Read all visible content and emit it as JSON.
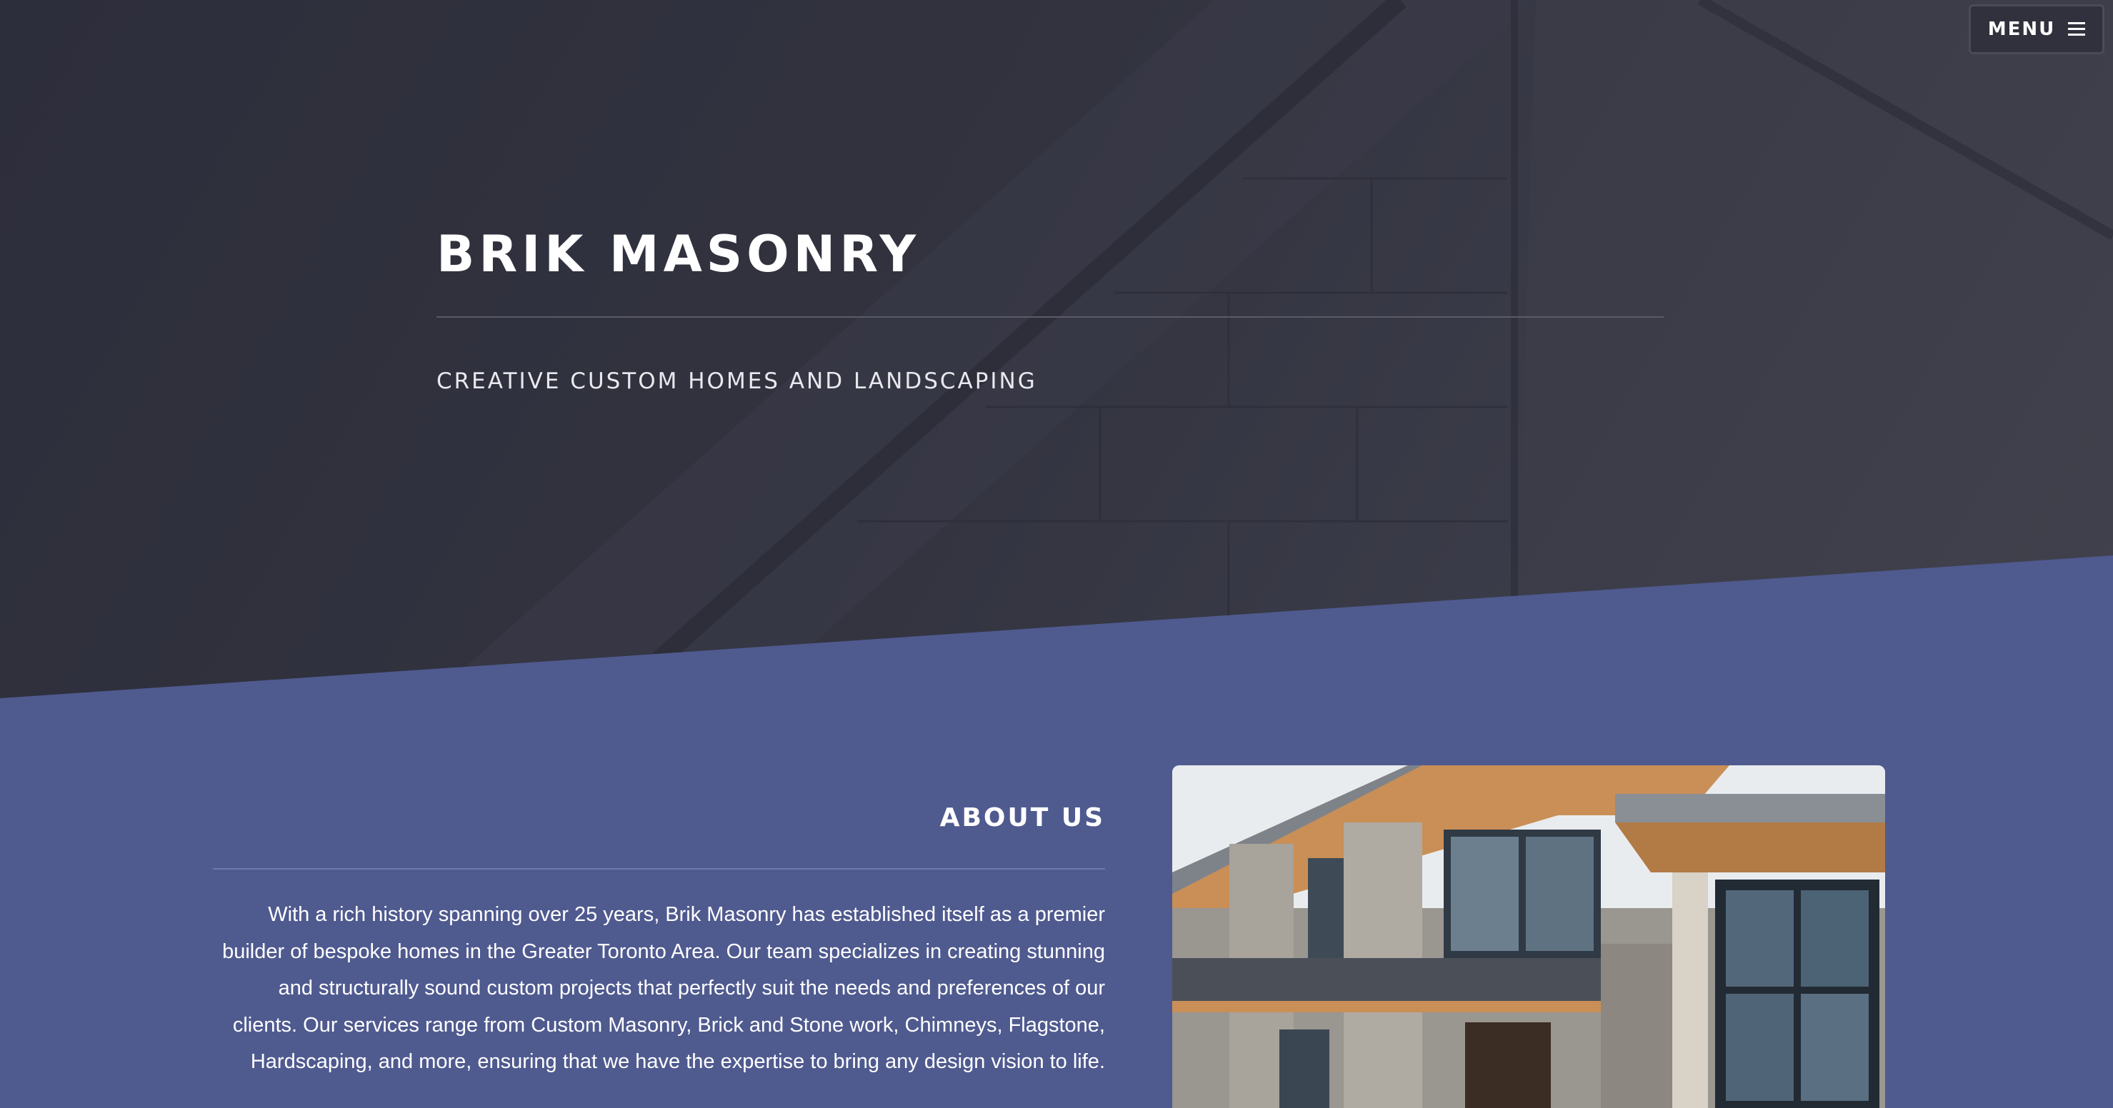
{
  "header": {
    "menu_label": "MENU",
    "menu_icon": "hamburger-icon"
  },
  "hero": {
    "title": "BRIK MASONRY",
    "subtitle": "CREATIVE CUSTOM HOMES AND LANDSCAPING"
  },
  "about": {
    "heading": "ABOUT US",
    "body": "With a rich history spanning over 25 years, Brik Masonry has established itself as a premier builder of bespoke homes in the Greater Toronto Area. Our team specializes in creating stunning and structurally sound custom projects that perfectly suit the needs and preferences of our clients. Our services range from Custom Masonry, Brick and Stone work, Chimneys, Flagstone, Hardscaping, and more, ensuring that we have the expertise to bring any design vision to life."
  },
  "colors": {
    "hero_bg": "#2f303c",
    "section_bg": "#4f5a8f",
    "text": "#ffffff"
  }
}
